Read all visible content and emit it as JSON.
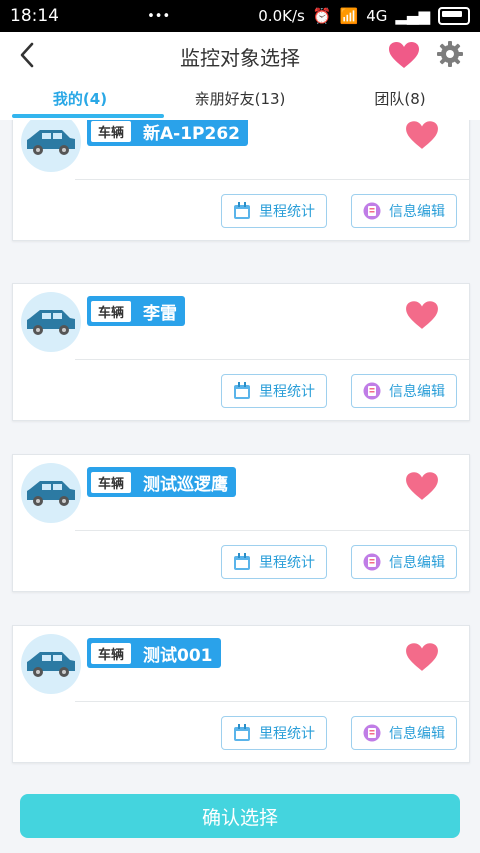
{
  "status_bar": {
    "time": "18:14",
    "dots": "•••",
    "net_speed": "0.0K/s",
    "network": "4G"
  },
  "header": {
    "title": "监控对象选择",
    "back_icon": "chevron-left-icon",
    "favorite_icon": "heart-icon",
    "settings_icon": "gear-icon"
  },
  "tabs": [
    {
      "label": "我的(4)",
      "active": true
    },
    {
      "label": "亲朋好友(13)",
      "active": false
    },
    {
      "label": "团队(8)",
      "active": false
    }
  ],
  "vehicles": [
    {
      "type": "车辆",
      "name": "新A-1P262",
      "stat_label": "里程统计",
      "edit_label": "信息编辑"
    },
    {
      "type": "车辆",
      "name": "李雷",
      "stat_label": "里程统计",
      "edit_label": "信息编辑"
    },
    {
      "type": "车辆",
      "name": "测试巡逻鹰",
      "stat_label": "里程统计",
      "edit_label": "信息编辑"
    },
    {
      "type": "车辆",
      "name": "测试001",
      "stat_label": "里程统计",
      "edit_label": "信息编辑"
    }
  ],
  "confirm": {
    "label": "确认选择"
  },
  "colors": {
    "accent": "#2aa2ea",
    "heart": "#f36b8a",
    "confirm": "#44d4de"
  }
}
